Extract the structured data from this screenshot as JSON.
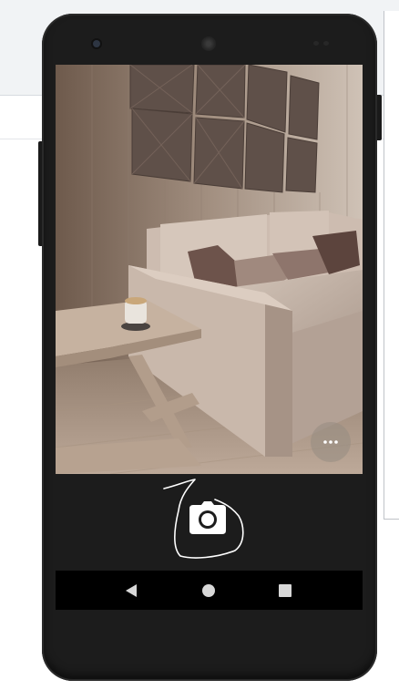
{
  "device": {
    "type": "android-phone"
  },
  "camera_app": {
    "preview_scene": "living-room-sofa",
    "more_button": {
      "icon": "more-horiz-icon"
    },
    "shutter_button": {
      "icon": "camera-icon"
    }
  },
  "navigation_bar": {
    "back": {
      "icon": "back-triangle-icon"
    },
    "home": {
      "icon": "home-circle-icon"
    },
    "recents": {
      "icon": "recents-square-icon"
    }
  },
  "colors": {
    "phone_body": "#1c1c1c",
    "screen_controls_bg": "#1c1c1c",
    "nav_bar_bg": "#000000",
    "annotation_stroke": "#ffffff"
  }
}
